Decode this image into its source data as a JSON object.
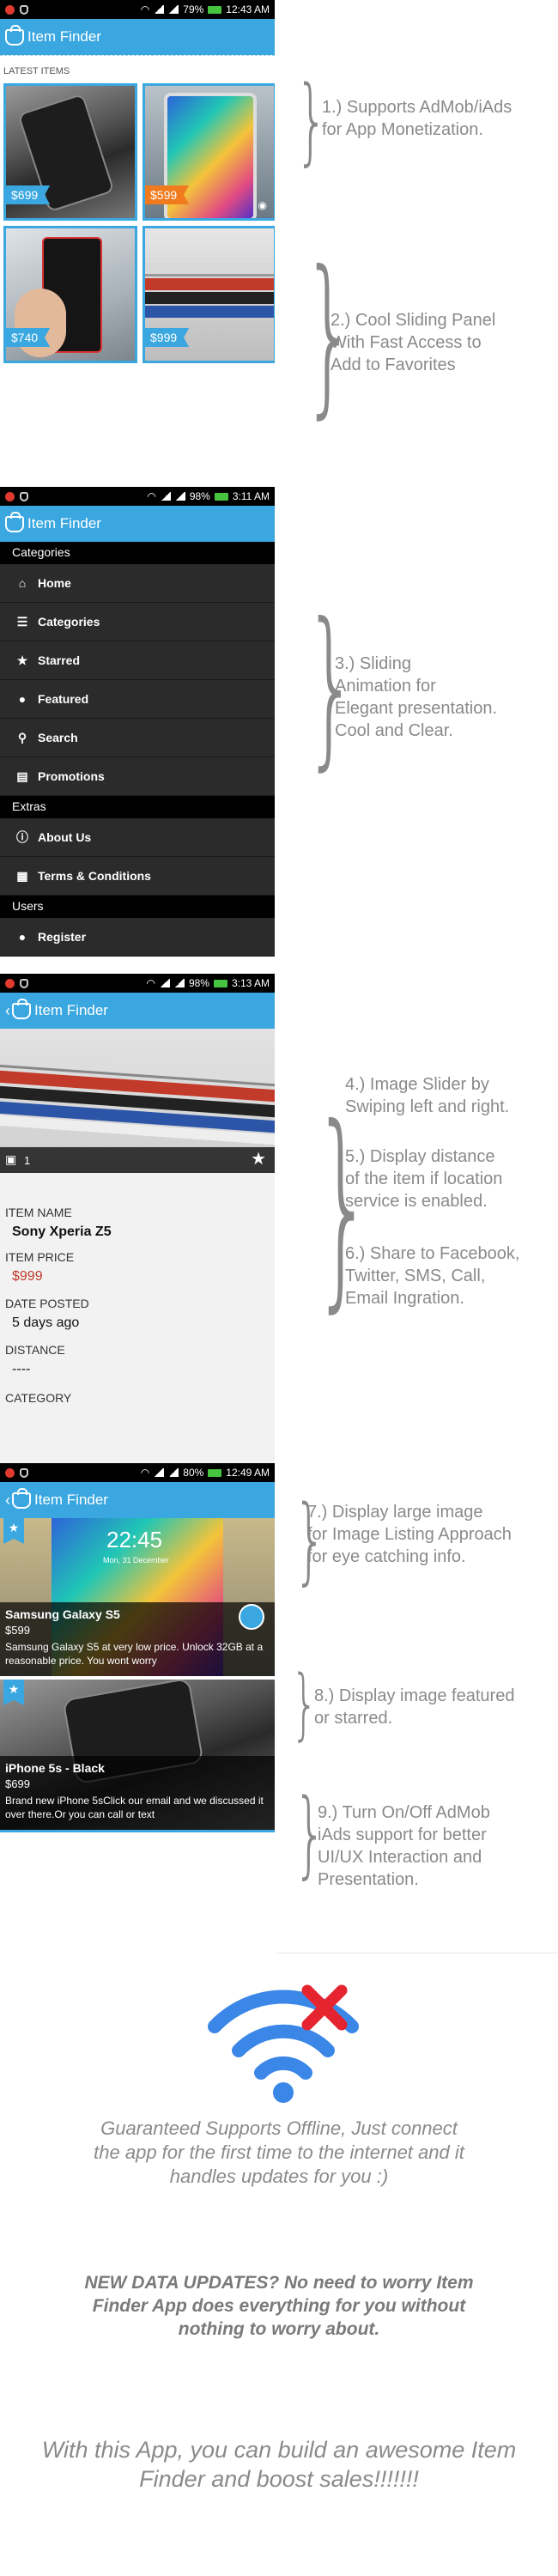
{
  "status": {
    "s1": {
      "battery": "79%",
      "time": "12:43 AM"
    },
    "s2": {
      "battery": "98%",
      "time": "3:11 AM"
    },
    "s3": {
      "battery": "98%",
      "time": "3:13 AM"
    },
    "s4": {
      "battery": "80%",
      "time": "12:49 AM"
    }
  },
  "app": {
    "title": "Item Finder"
  },
  "screen1": {
    "section_label": "LATEST ITEMS",
    "tiles": [
      {
        "price": "$699",
        "tag_color": "#3aa7e0"
      },
      {
        "price": "$599",
        "tag_color": "#f07b1e"
      },
      {
        "price": "$740",
        "tag_color": "#3aa7e0"
      },
      {
        "price": "$999",
        "tag_color": "#3aa7e0"
      }
    ]
  },
  "drawer": {
    "categories_header": "Categories",
    "extras_header": "Extras",
    "users_header": "Users",
    "items": [
      {
        "label": "Home",
        "icon": "home-icon"
      },
      {
        "label": "Categories",
        "icon": "list-icon"
      },
      {
        "label": "Starred",
        "icon": "star-icon"
      },
      {
        "label": "Featured",
        "icon": "circle-icon"
      },
      {
        "label": "Search",
        "icon": "search-icon"
      },
      {
        "label": "Promotions",
        "icon": "newspaper-icon"
      }
    ],
    "extras": [
      {
        "label": "About Us",
        "icon": "info-icon"
      },
      {
        "label": "Terms & Conditions",
        "icon": "document-icon"
      }
    ],
    "users": [
      {
        "label": "Register",
        "icon": "user-icon"
      }
    ]
  },
  "detail": {
    "image_count": "1",
    "item_name_label": "ITEM NAME",
    "item_name": "Sony Xperia Z5",
    "item_price_label": "ITEM PRICE",
    "item_price": "$999",
    "date_label": "DATE POSTED",
    "date": "5 days ago",
    "distance_label": "DISTANCE",
    "distance": "----",
    "category_label": "CATEGORY"
  },
  "listing": {
    "phone_time_text": "22:45",
    "phone_date_text": "Mon, 31 December",
    "cards": [
      {
        "title": "Samsung Galaxy S5",
        "price": "$599",
        "desc": "Samsung Galaxy S5 at very low price. Unlock 32GB at a reasonable price. You wont worry"
      },
      {
        "title": "iPhone 5s - Black",
        "price": "$699",
        "desc": "Brand new iPhone 5sClick our email and we discussed it over there.Or you can call or text"
      }
    ]
  },
  "callouts": {
    "c1": [
      "1.) Supports AdMob/iAds",
      "for App Monetization."
    ],
    "c2": [
      "2.) Cool Sliding Panel",
      "With Fast Access to",
      "Add to Favorites"
    ],
    "c3": [
      "3.) Sliding",
      "Animation for",
      "Elegant presentation.",
      "Cool and Clear."
    ],
    "c4": [
      "4.) Image Slider by",
      "Swiping left and right."
    ],
    "c5": [
      "5.) Display distance",
      "of the item if location",
      "service is enabled."
    ],
    "c6": [
      "6.) Share to Facebook,",
      "Twitter, SMS, Call,",
      "Email Ingration."
    ],
    "c7": [
      "7.) Display large image",
      "for Image Listing Approach",
      "for eye catching info."
    ],
    "c8": [
      "8.) Display image featured",
      "or starred."
    ],
    "c9": [
      "9.) Turn On/Off AdMob",
      "iAds support for better",
      "UI/UX Interaction and",
      "Presentation."
    ]
  },
  "footer": {
    "offline_text": "Guaranteed Supports Offline, Just connect the app for the first time to the internet and it handles updates for you :)",
    "updates_text": "NEW DATA UPDATES? No need to worry Item Finder App does everything for you without nothing to worry about.",
    "closing_text": "With this App, you can build an awesome Item Finder and boost sales!!!!!!!"
  },
  "colors": {
    "accent": "#3aa7e0",
    "price_red": "#c0392b",
    "orange": "#f07b1e",
    "wifi_blue": "#3b87e8",
    "cross_red": "#e52430"
  }
}
